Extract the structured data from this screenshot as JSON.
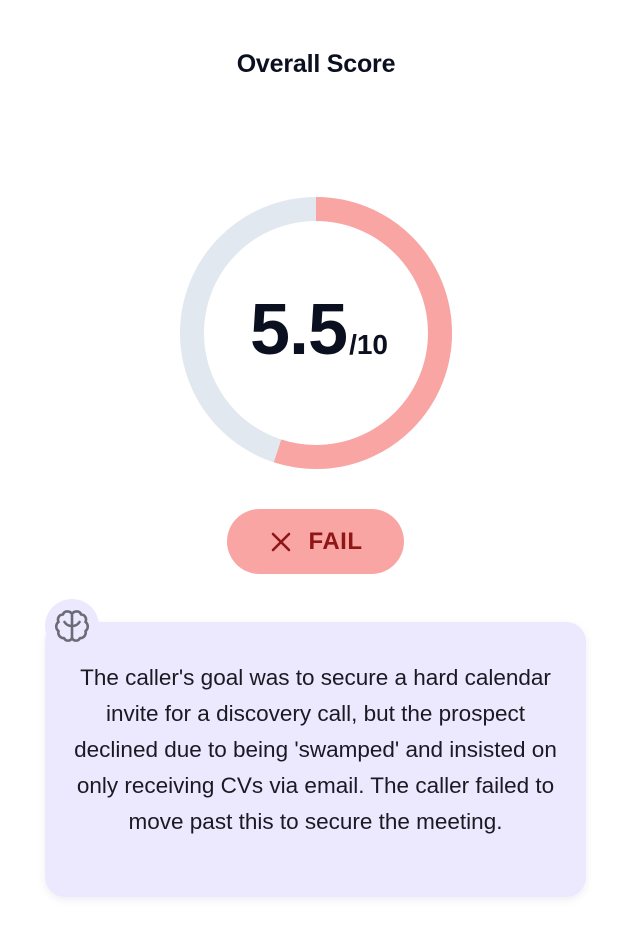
{
  "header": {
    "title": "Overall Score"
  },
  "score": {
    "value": "5.5",
    "max": "/10",
    "fraction": 0.55,
    "colors": {
      "progress": "#f9a5a3",
      "track": "#e2e8f0"
    }
  },
  "status": {
    "label": "FAIL",
    "icon": "x-icon",
    "colors": {
      "background": "#f9a5a3",
      "text": "#8f1616"
    }
  },
  "reasoning": {
    "icon": "brain-icon",
    "background": "#ece8fd",
    "text": "The caller's goal was to secure a hard calendar invite for a discovery call, but the prospect declined due to being 'swamped' and insisted on only receiving CVs via email. The caller failed to move past this to secure the meeting."
  }
}
